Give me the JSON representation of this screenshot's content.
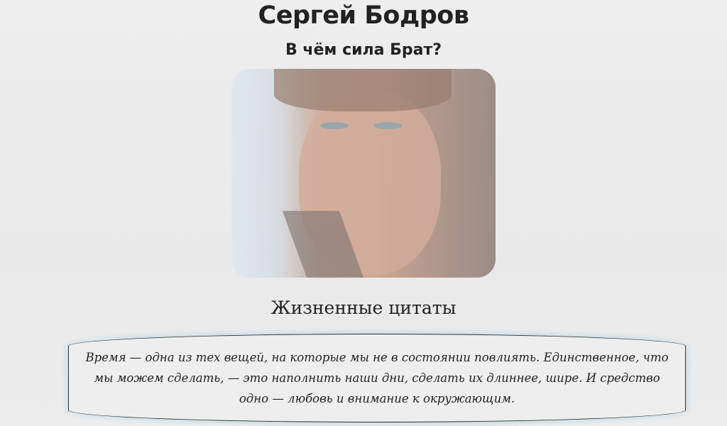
{
  "header": {
    "title": "Сергей Бодров",
    "subtitle": "В чём сила Брат?"
  },
  "photo": {
    "alt": "portrait"
  },
  "quotes": {
    "heading": "Жизненные цитаты",
    "items": [
      "Время — одна из тех вещей, на которые мы не в состоянии повлиять. Единственное, что мы можем сделать, — это наполнить наши дни, сделать их длиннее, шире. И средство одно — любовь и внимание к окружающим."
    ]
  }
}
